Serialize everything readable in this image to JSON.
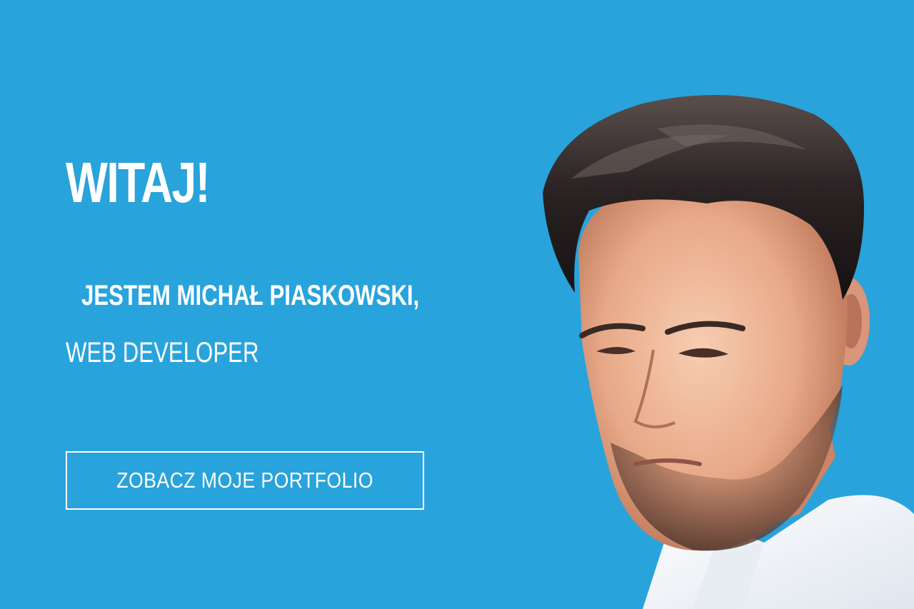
{
  "hero": {
    "greeting": "WITAJ!",
    "intro": "JESTEM MICHAŁ PIASKOWSKI,",
    "role": "WEB DEVELOPER",
    "cta_label": "ZOBACZ MOJE PORTFOLIO",
    "background_color": "#29a3db",
    "text_color": "#ffffff"
  }
}
